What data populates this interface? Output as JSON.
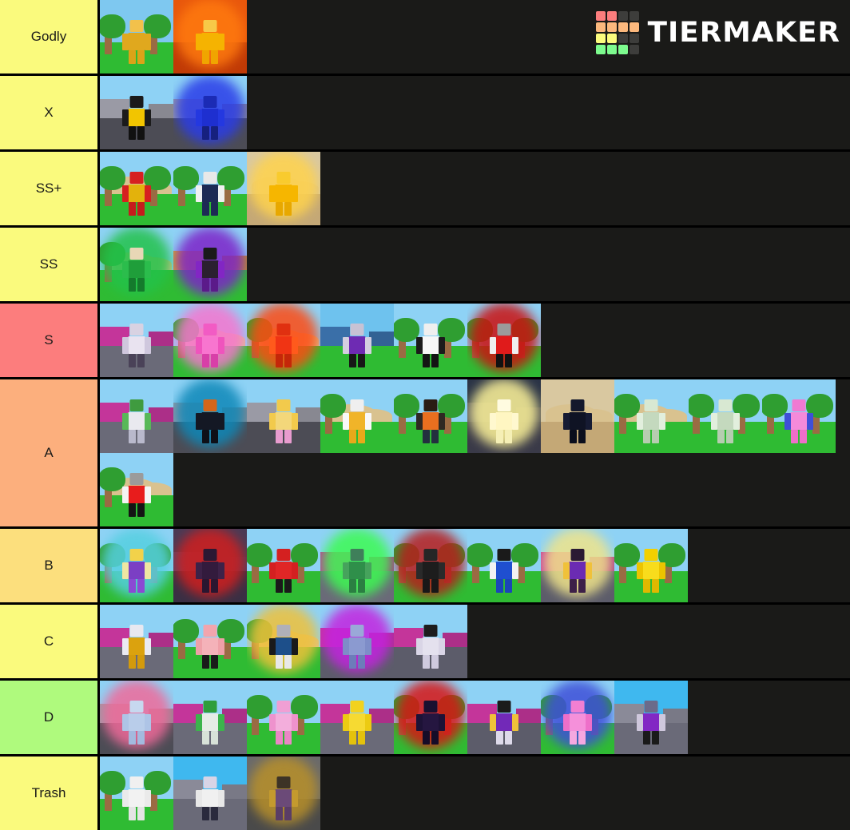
{
  "app": {
    "brand_name": "TIERMAKER",
    "logo_icon": "tiermaker-grid-logo",
    "background_color": "#1a1a18",
    "border_color": "#000000"
  },
  "logo_grid": {
    "colors": [
      "#fb7d7d",
      "#fb7d7d",
      "#3d3d3b",
      "#3d3d3b",
      "#fbb87d",
      "#fbb87d",
      "#fbb87d",
      "#fbb87d",
      "#fbfb7d",
      "#fbfb7d",
      "#3d3d3b",
      "#3d3d3b",
      "#7dfb8e",
      "#7dfb8e",
      "#7dfb8e",
      "#3d3d3b"
    ]
  },
  "tiers": [
    {
      "label": "Godly",
      "color": "#fafa7d",
      "rows": 1,
      "items": [
        {
          "name": "golden-blocky-figure",
          "scene": "grass-field",
          "char": {
            "head": "#f2c14b",
            "torso": "#e0a81e",
            "arms": "#e0a81e",
            "legs": "#dba318"
          },
          "aura": ""
        },
        {
          "name": "fire-aura-golden-titan",
          "scene": "fire",
          "char": {
            "head": "#f7c948",
            "torso": "#f5b301",
            "arms": "#f5b301",
            "legs": "#f0a500"
          },
          "aura": "#ff7a0f"
        }
      ]
    },
    {
      "label": "X",
      "color": "#fafa7d",
      "rows": 1,
      "items": [
        {
          "name": "yellow-black-scorpion-figure",
          "scene": "city-street",
          "char": {
            "head": "#1a1a1a",
            "torso": "#f2c500",
            "arms": "#1b1b1b",
            "legs": "#111111"
          },
          "aura": ""
        },
        {
          "name": "blue-armored-figure",
          "scene": "city-street",
          "char": {
            "head": "#1b2bb5",
            "torso": "#1e2fd0",
            "arms": "#2438e0",
            "legs": "#16207f"
          },
          "aura": "#2a3ce8"
        }
      ]
    },
    {
      "label": "SS+",
      "color": "#fafa7d",
      "rows": 1,
      "items": [
        {
          "name": "red-gold-warrior",
          "scene": "grass-beach",
          "char": {
            "head": "#d62020",
            "torso": "#e3b20c",
            "arms": "#d62020",
            "legs": "#c51c1c"
          },
          "aura": ""
        },
        {
          "name": "navy-white-striped-figure",
          "scene": "grass-tree",
          "char": {
            "head": "#e8e8e8",
            "torso": "#1d2a55",
            "arms": "#f0f0f0",
            "legs": "#1d2a55"
          },
          "aura": ""
        },
        {
          "name": "golden-radiant-figure",
          "scene": "desert",
          "char": {
            "head": "#f9cb2e",
            "torso": "#f6b600",
            "arms": "#f6b600",
            "legs": "#e8a800"
          },
          "aura": "#ffd34d"
        }
      ]
    },
    {
      "label": "SS",
      "color": "#fafa7d",
      "rows": 1,
      "items": [
        {
          "name": "green-crystal-figure",
          "scene": "grass-hill",
          "char": {
            "head": "#e8d7b6",
            "torso": "#1f9e3a",
            "arms": "#2bbd4c",
            "legs": "#147a2c"
          },
          "aura": "#23c24a"
        },
        {
          "name": "purple-black-armored-figure",
          "scene": "town",
          "char": {
            "head": "#1a1a1a",
            "torso": "#2b2030",
            "arms": "#8226c4",
            "legs": "#5b1a8a"
          },
          "aura": "#7d22c9"
        }
      ]
    },
    {
      "label": "S",
      "color": "#fc7d7d",
      "rows": 1,
      "items": [
        {
          "name": "white-red-diamond-pattern-figure",
          "scene": "pink-town",
          "char": {
            "head": "#d8d2e2",
            "torso": "#e9e3f0",
            "arms": "#cfc7dd",
            "legs": "#4a4258"
          },
          "aura": ""
        },
        {
          "name": "pink-magenta-figure",
          "scene": "grass-hill",
          "char": {
            "head": "#f25bc4",
            "torso": "#f875cf",
            "arms": "#ef54bd",
            "legs": "#d83fa8"
          },
          "aura": "#f875cf"
        },
        {
          "name": "red-flame-figure",
          "scene": "grass-hill",
          "char": {
            "head": "#e03010",
            "torso": "#f03414",
            "arms": "#ff5a1c",
            "legs": "#c52709"
          },
          "aura": "#ff4a12"
        },
        {
          "name": "purple-white-sign-figure",
          "scene": "bridge",
          "char": {
            "head": "#c7c2d4",
            "torso": "#6e2bb3",
            "arms": "#d4cfe0",
            "legs": "#171717"
          },
          "aura": ""
        },
        {
          "name": "white-shirt-hat-figure",
          "scene": "grass-tree",
          "char": {
            "head": "#efefef",
            "torso": "#f7f7f7",
            "arms": "#1b1b1b",
            "legs": "#141414"
          },
          "aura": ""
        },
        {
          "name": "red-black-figure-with-effect",
          "scene": "grass-tree",
          "char": {
            "head": "#9b9b9b",
            "torso": "#e01b1b",
            "arms": "#efefef",
            "legs": "#121212"
          },
          "aura": "#cc1010"
        }
      ]
    },
    {
      "label": "A",
      "color": "#fcaf7d",
      "rows": 2,
      "items": [
        {
          "name": "green-monster-figure",
          "scene": "pink-town",
          "char": {
            "head": "#3f9b3f",
            "torso": "#e9e9ef",
            "arms": "#58b858",
            "legs": "#b9b9cc"
          },
          "aura": ""
        },
        {
          "name": "dark-pumpkin-head-figure",
          "scene": "city-street",
          "char": {
            "head": "#d4661a",
            "torso": "#141824",
            "arms": "#141824",
            "legs": "#0e1018"
          },
          "aura": "#0e88b8"
        },
        {
          "name": "golden-pink-armored-figure",
          "scene": "city-street",
          "char": {
            "head": "#f2ca4c",
            "torso": "#f3d77a",
            "arms": "#f2ca4c",
            "legs": "#e89ccf"
          },
          "aura": ""
        },
        {
          "name": "gold-white-knight",
          "scene": "grass-hill",
          "char": {
            "head": "#efefef",
            "torso": "#f0b429",
            "arms": "#f8f8f8",
            "legs": "#e8a91a"
          },
          "aura": ""
        },
        {
          "name": "orange-suit-figure",
          "scene": "grass-tree",
          "char": {
            "head": "#2a1c14",
            "torso": "#e96f1f",
            "arms": "#2e2822",
            "legs": "#23303f"
          },
          "aura": ""
        },
        {
          "name": "white-glowing-figure",
          "scene": "night-street",
          "char": {
            "head": "#fffbe0",
            "torso": "#fff6c2",
            "arms": "#fff8cf",
            "legs": "#f5efb5"
          },
          "aura": "#fff59a"
        },
        {
          "name": "dark-navy-cloaked-figure",
          "scene": "desert",
          "char": {
            "head": "#14182c",
            "torso": "#0f1324",
            "arms": "#161b33",
            "legs": "#0b0e1c"
          },
          "aura": ""
        },
        {
          "name": "green-white-mech-figure",
          "scene": "grass-hill",
          "scene2": "grass-tree",
          "char": {
            "head": "#d8e8d2",
            "torso": "#c4d9be",
            "arms": "#e2efdd",
            "legs": "#b6cdb0"
          },
          "aura": "",
          "wide": true
        },
        {
          "name": "pink-blue-robot",
          "scene": "grass-tree",
          "char": {
            "head": "#f07ad2",
            "torso": "#f58ada",
            "arms": "#3f4fd8",
            "legs": "#ef6ec9"
          },
          "aura": ""
        },
        {
          "name": "red-white-shirt-figure",
          "scene": "grass-hill",
          "char": {
            "head": "#9b9b9b",
            "torso": "#e81c1c",
            "arms": "#f4f4f4",
            "legs": "#141414"
          },
          "aura": ""
        }
      ]
    },
    {
      "label": "B",
      "color": "#fcdf7d",
      "rows": 1,
      "items": [
        {
          "name": "purple-gold-magic-figure",
          "scene": "grass-tree",
          "char": {
            "head": "#f2d24a",
            "torso": "#7b3fc4",
            "arms": "#efe6a2",
            "legs": "#8b4ad4"
          },
          "aura": "#55cfe0"
        },
        {
          "name": "dark-purple-shadow-figure",
          "scene": "dark-town",
          "char": {
            "head": "#2b1833",
            "torso": "#331b3d",
            "arms": "#3d2248",
            "legs": "#2a1630"
          },
          "aura": "#d01f1f"
        },
        {
          "name": "red-demon-figure",
          "scene": "grass-tree",
          "char": {
            "head": "#d42020",
            "torso": "#e02626",
            "arms": "#d42020",
            "legs": "#1a1a1a"
          },
          "aura": ""
        },
        {
          "name": "green-neon-armored-figure",
          "scene": "pink-town",
          "char": {
            "head": "#3f7f5a",
            "torso": "#2f8f4a",
            "arms": "#46a35c",
            "legs": "#2b7f42"
          },
          "aura": "#3dfb52"
        },
        {
          "name": "dark-cage-structure",
          "scene": "grass-tree",
          "char": {
            "head": "#262626",
            "torso": "#1d1d1d",
            "arms": "#2a2a2a",
            "legs": "#181818"
          },
          "aura": "#b81c1c"
        },
        {
          "name": "blue-white-armored-figure",
          "scene": "grass-tree",
          "char": {
            "head": "#1a1a1a",
            "torso": "#1f4fd0",
            "arms": "#f2f2f2",
            "legs": "#1b45b8"
          },
          "aura": ""
        },
        {
          "name": "purple-gold-truck-figure",
          "scene": "pink-street",
          "char": {
            "head": "#2a1a33",
            "torso": "#6b2bb3",
            "arms": "#f0c13a",
            "legs": "#3d2048"
          },
          "aura": "#f0e48a"
        },
        {
          "name": "yellow-gold-crystal-figure",
          "scene": "grass-tree",
          "char": {
            "head": "#f2d000",
            "torso": "#f8dc1c",
            "arms": "#ecc400",
            "legs": "#e0b800"
          },
          "aura": ""
        }
      ]
    },
    {
      "label": "C",
      "color": "#fafa7d",
      "rows": 1,
      "items": [
        {
          "name": "gold-white-armored-figure",
          "scene": "pink-town",
          "char": {
            "head": "#e8e8f0",
            "torso": "#dba20e",
            "arms": "#eaeaf2",
            "legs": "#d39a0c"
          },
          "aura": ""
        },
        {
          "name": "pink-muscular-figure",
          "scene": "grass-tree",
          "char": {
            "head": "#f2a5ad",
            "torso": "#f4b2b9",
            "arms": "#efa0a8",
            "legs": "#1a1a1a"
          },
          "aura": ""
        },
        {
          "name": "blue-gold-winged-figure",
          "scene": "grass-hill",
          "char": {
            "head": "#b0b0b8",
            "torso": "#1d4f8a",
            "arms": "#1a1a1a",
            "legs": "#e8e8e8"
          },
          "aura": "#f0c13a"
        },
        {
          "name": "blue-knight-with-sword",
          "scene": "pink-street",
          "char": {
            "head": "#9aa8d8",
            "torso": "#8b9ad0",
            "arms": "#7e8dc8",
            "legs": "#6d7cba"
          },
          "aura": "#c423e0"
        },
        {
          "name": "white-black-striped-figure",
          "scene": "pink-street",
          "char": {
            "head": "#1d1d1d",
            "torso": "#e4e1ee",
            "arms": "#d9d5e6",
            "legs": "#cfcade"
          },
          "aura": ""
        }
      ]
    },
    {
      "label": "D",
      "color": "#affa7d",
      "rows": 1,
      "items": [
        {
          "name": "blue-pink-armored-figure",
          "scene": "city-street",
          "char": {
            "head": "#c7d8ef",
            "torso": "#b9cdea",
            "arms": "#aec4e6",
            "legs": "#a3bade"
          },
          "aura": "#f06a9a"
        },
        {
          "name": "green-white-armored-figure",
          "scene": "pink-town",
          "char": {
            "head": "#2f9e3a",
            "torso": "#e6ece6",
            "arms": "#3cb44c",
            "legs": "#d8e2d8"
          },
          "aura": ""
        },
        {
          "name": "pink-small-creature",
          "scene": "grass-tree",
          "char": {
            "head": "#f09fd4",
            "torso": "#f3aedc",
            "arms": "#ee92cd",
            "legs": "#eb86c6"
          },
          "aura": ""
        },
        {
          "name": "yellow-blocky-figure",
          "scene": "pink-town",
          "char": {
            "head": "#f2d21e",
            "torso": "#f6da32",
            "arms": "#eccb12",
            "legs": "#e4c20c"
          },
          "aura": ""
        },
        {
          "name": "dark-red-shield-object",
          "scene": "grass-tree",
          "char": {
            "head": "#1a1030",
            "torso": "#251640",
            "arms": "#1d1236",
            "legs": "#150c28"
          },
          "aura": "#d81414"
        },
        {
          "name": "purple-gold-vampire-figure",
          "scene": "pink-street",
          "char": {
            "head": "#1b1b1b",
            "torso": "#7229b8",
            "arms": "#f0c13a",
            "legs": "#dedaea"
          },
          "aura": ""
        },
        {
          "name": "pink-robot-figure",
          "scene": "grass-tree",
          "char": {
            "head": "#f27fd2",
            "torso": "#f590da",
            "arms": "#ee6fc9",
            "legs": "#f5a8e0"
          },
          "aura": "#3f4fd8"
        },
        {
          "name": "purple-hooded-figure",
          "scene": "blue-street",
          "char": {
            "head": "#6b6b8a",
            "torso": "#8228c4",
            "arms": "#cfc8dd",
            "legs": "#1a1a1a"
          },
          "aura": ""
        }
      ]
    },
    {
      "label": "Trash",
      "color": "#fafa7d",
      "rows": 1,
      "items": [
        {
          "name": "white-red-diamond-block-figure",
          "scene": "grass-tree",
          "char": {
            "head": "#f0f0f0",
            "torso": "#f2f2f2",
            "arms": "#eaeaea",
            "legs": "#e4e4e4"
          },
          "aura": ""
        },
        {
          "name": "white-red-diamond-vehicle",
          "scene": "blue-street",
          "char": {
            "head": "#d8d4e6",
            "torso": "#f0f0f0",
            "arms": "#e8e8e8",
            "legs": "#2a2a3d"
          },
          "aura": ""
        },
        {
          "name": "golden-purple-dark-figure",
          "scene": "dark-wall",
          "char": {
            "head": "#3d3326",
            "torso": "#6b4a78",
            "arms": "#c49a2e",
            "legs": "#5a3d66"
          },
          "aura": "#b8902a"
        }
      ]
    }
  ]
}
